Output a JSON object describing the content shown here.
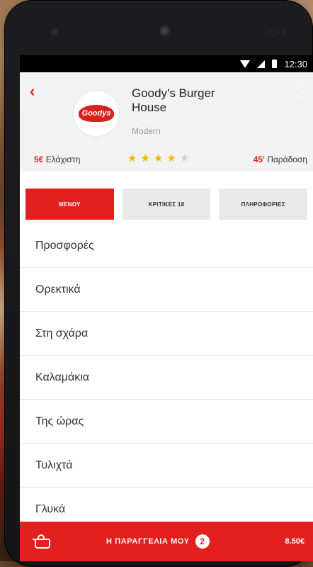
{
  "status_bar": {
    "time": "12:30"
  },
  "restaurant": {
    "name": "Goody's Burger House",
    "category": "Modern",
    "logo_text": "Goodys",
    "min_order_value": "5€",
    "min_order_label": "Ελάχιστη",
    "delivery_minutes": "45'",
    "delivery_label": "Παράδοση",
    "rating": 4,
    "rating_max": 5
  },
  "tabs": [
    {
      "label": "ΜΕΝΟΥ",
      "active": true
    },
    {
      "label": "ΚΡΙΤΙΚΕΣ 18",
      "active": false
    },
    {
      "label": "ΠΛΗΡΟΦΟΡΙΕΣ",
      "active": false
    }
  ],
  "menu": [
    {
      "label": "Προσφορές"
    },
    {
      "label": "Ορεκτικά"
    },
    {
      "label": "Στη σχάρα"
    },
    {
      "label": "Καλαμάκια"
    },
    {
      "label": "Της ώρας"
    },
    {
      "label": "Τυλιχτά"
    },
    {
      "label": "Γλυκά"
    }
  ],
  "order_bar": {
    "label": "Η ΠΑΡΑΓΓΕΛΙΑ ΜΟΥ",
    "count": "2",
    "total": "8.50€"
  },
  "colors": {
    "accent": "#e41f1f",
    "star": "#f5b400"
  }
}
